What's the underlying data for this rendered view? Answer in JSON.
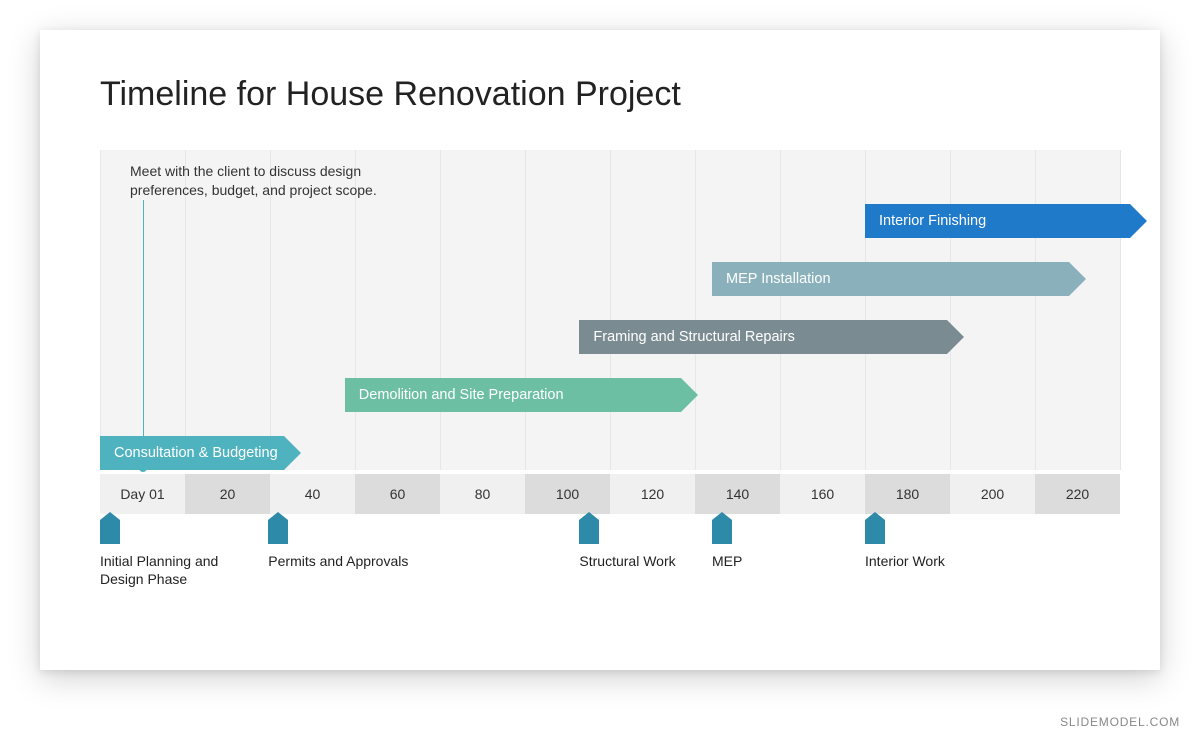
{
  "title": "Timeline for House Renovation Project",
  "annotation": "Meet with the client to discuss design preferences, budget, and project scope.",
  "watermark": "SLIDEMODEL.COM",
  "axis": [
    "Day 01",
    "20",
    "40",
    "60",
    "80",
    "100",
    "120",
    "140",
    "160",
    "180",
    "200",
    "220"
  ],
  "bars": [
    {
      "label": "Consultation & Budgeting",
      "color": "#4fb3bf",
      "left_pct": 0,
      "width_pct": 18,
      "row": 4
    },
    {
      "label": "Demolition and Site Preparation",
      "color": "#6cbfa3",
      "left_pct": 24,
      "width_pct": 33,
      "row": 3
    },
    {
      "label": "Framing and Structural Repairs",
      "color": "#7a8b91",
      "left_pct": 47,
      "width_pct": 36,
      "row": 2
    },
    {
      "label": "MEP Installation",
      "color": "#8ab1bb",
      "left_pct": 60,
      "width_pct": 35,
      "row": 1
    },
    {
      "label": "Interior Finishing",
      "color": "#1f7ac9",
      "left_pct": 75,
      "width_pct": 26,
      "row": 0
    }
  ],
  "milestones": [
    {
      "label": "Initial Planning and Design Phase",
      "pos_pct": 0
    },
    {
      "label": "Permits and Approvals",
      "pos_pct": 16.5
    },
    {
      "label": "Structural Work",
      "pos_pct": 47
    },
    {
      "label": "MEP",
      "pos_pct": 60
    },
    {
      "label": "Interior Work",
      "pos_pct": 75
    }
  ],
  "chart_data": {
    "type": "gantt",
    "title": "Timeline for House Renovation Project",
    "xlabel": "Day",
    "x_ticks": [
      1,
      20,
      40,
      60,
      80,
      100,
      120,
      140,
      160,
      180,
      200,
      220
    ],
    "xlim": [
      0,
      230
    ],
    "tasks": [
      {
        "name": "Consultation & Budgeting",
        "start_day": 1,
        "end_day": 40,
        "color": "#4fb3bf",
        "note": "Meet with the client to discuss design preferences, budget, and project scope."
      },
      {
        "name": "Demolition and Site Preparation",
        "start_day": 55,
        "end_day": 130,
        "color": "#6cbfa3"
      },
      {
        "name": "Framing and Structural Repairs",
        "start_day": 108,
        "end_day": 190,
        "color": "#7a8b91"
      },
      {
        "name": "MEP Installation",
        "start_day": 138,
        "end_day": 220,
        "color": "#8ab1bb"
      },
      {
        "name": "Interior Finishing",
        "start_day": 172,
        "end_day": 230,
        "color": "#1f7ac9"
      }
    ],
    "milestones": [
      {
        "name": "Initial Planning and Design Phase",
        "day": 1
      },
      {
        "name": "Permits and Approvals",
        "day": 40
      },
      {
        "name": "Structural Work",
        "day": 108
      },
      {
        "name": "MEP",
        "day": 138
      },
      {
        "name": "Interior Work",
        "day": 172
      }
    ]
  }
}
